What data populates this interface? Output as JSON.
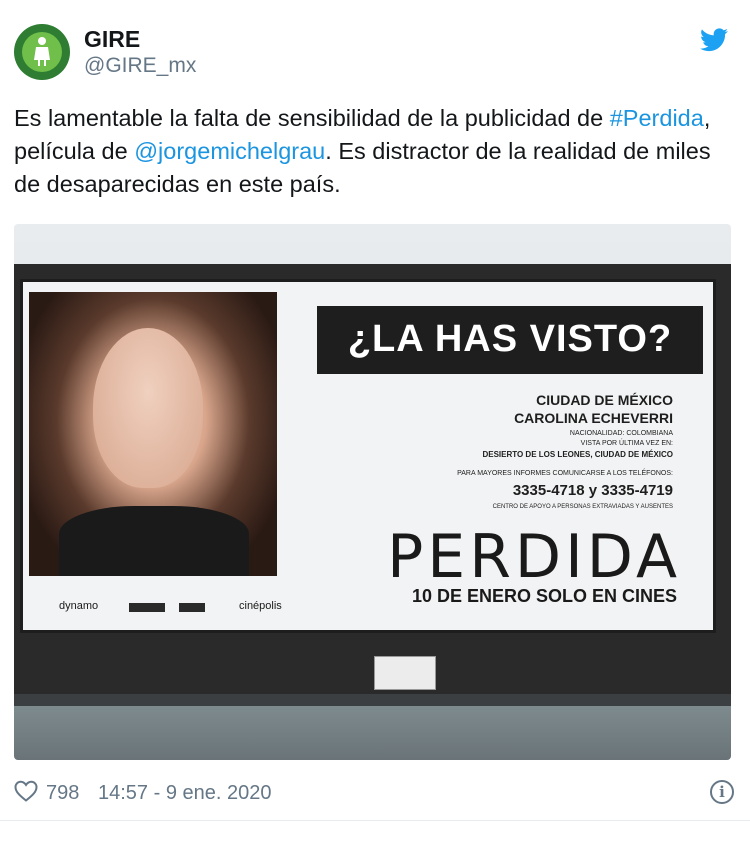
{
  "author": {
    "display_name": "GIRE",
    "handle": "@GIRE_mx",
    "avatar_icon": "gire-logo-avatar"
  },
  "platform_icon": "twitter-bird-icon",
  "tweet": {
    "text_1": "Es lamentable la falta de sensibilidad de la publicidad de",
    "hashtag": "#Perdida",
    "text_2": ", película de ",
    "mention": "@jorgemichelgrau",
    "text_3": ".  Es distractor de la realidad de miles de desaparecidas en este país."
  },
  "media": {
    "headline": "¿LA HAS VISTO?",
    "city": "CIUDAD DE MÉXICO",
    "name": "CAROLINA ECHEVERRI",
    "nationality": "NACIONALIDAD: COLOMBIANA",
    "last_seen": "VISTA POR ÚLTIMA VEZ EN:",
    "location": "DESIERTO DE LOS LEONES, CIUDAD DE MÉXICO",
    "info_prompt": "PARA MAYORES INFORMES COMUNICARSE A LOS TELÉFONOS:",
    "phones": "3335-4718 y 3335-4719",
    "center": "CENTRO DE APOYO A PERSONAS EXTRAVIADAS Y AUSENTES",
    "movie_title": "PERDIDA",
    "release": "10 DE ENERO SOLO EN CINES",
    "logo_1": "dynamo",
    "logo_2": "cinépolis"
  },
  "footer": {
    "likes": "798",
    "timestamp": "14:57 - 9 ene. 2020",
    "like_icon": "heart-icon",
    "info_icon": "info-icon"
  },
  "colors": {
    "link": "#1b95e0",
    "secondary_text": "#657786",
    "twitter_blue": "#1da1f2"
  }
}
